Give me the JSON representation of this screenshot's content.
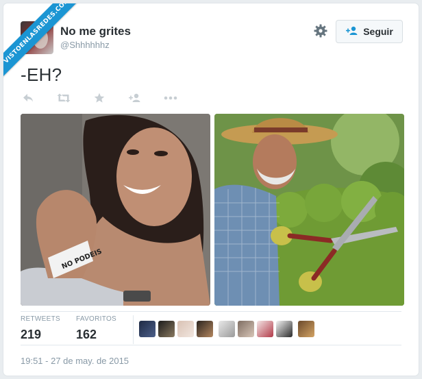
{
  "watermark": {
    "text": "VISTOENLASREDES.COM"
  },
  "tweet": {
    "author": {
      "name": "No me grites",
      "handle": "@Shhhhhhz"
    },
    "follow_label": "Seguir",
    "text": "-EH?",
    "actions": [
      "reply-icon",
      "retweet-icon",
      "favorite-icon",
      "follow-icon",
      "more-icon"
    ],
    "photos": [
      {
        "name": "photo-woman-wristband",
        "wristband_text": "NO PODEIS"
      },
      {
        "name": "photo-gardener-shears"
      }
    ],
    "stats": {
      "retweets_label": "RETWEETS",
      "retweets_value": "219",
      "favorites_label": "FAVORITOS",
      "favorites_value": "162"
    },
    "favoriters_count": 9,
    "timestamp": "19:51 - 27 de may. de 2015"
  },
  "colors": {
    "accent": "#1b95d3",
    "text": "#292f33",
    "muted": "#8899a6",
    "border": "#e1e8ed"
  }
}
